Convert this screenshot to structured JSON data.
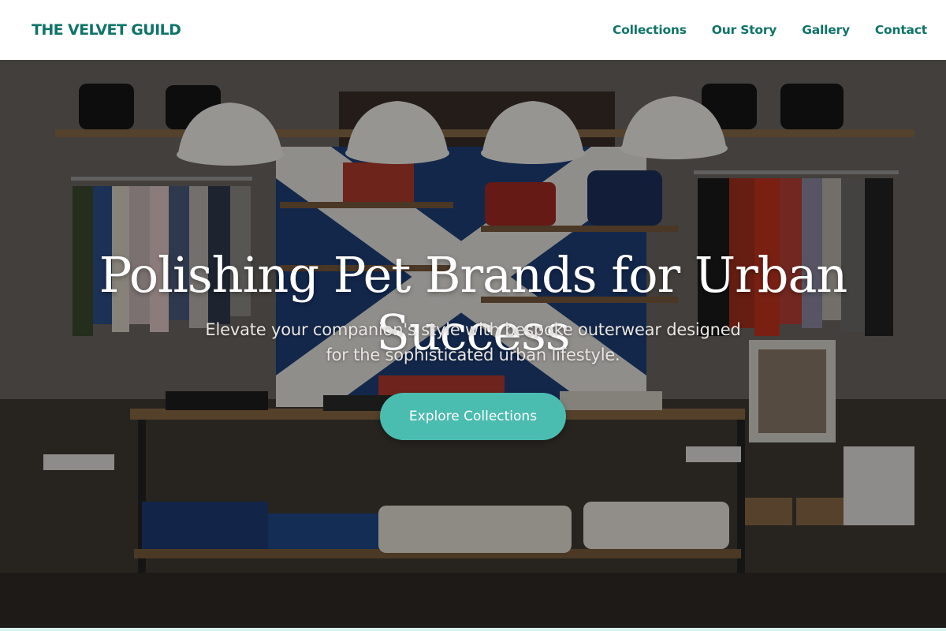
{
  "header": {
    "brand": "THE VELVET GUILD",
    "nav": [
      "Collections",
      "Our Story",
      "Gallery",
      "Contact"
    ]
  },
  "hero": {
    "title": "Polishing Pet Brands for Urban Success",
    "subtitle": "Elevate your companion's style with bespoke outerwear designed for the sophisticated urban lifestyle.",
    "cta_label": "Explore Collections",
    "background_icon": "boutique-interior-photo"
  },
  "colors": {
    "brand": "#0f7468",
    "cta": "#4bbcb0",
    "header_bg": "#ffffff"
  }
}
